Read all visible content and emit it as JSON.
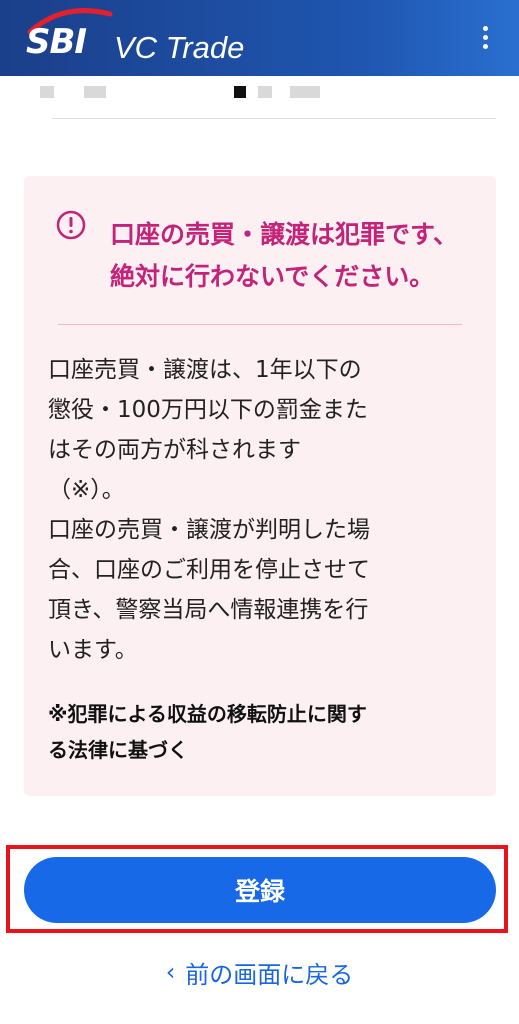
{
  "header": {
    "logo_sbi": "SBI",
    "logo_text": "VC Trade",
    "menu_icon": "kebab-menu-icon",
    "brand_color": "#1f56b0"
  },
  "warning": {
    "icon": "exclamation-circle-icon",
    "title": "口座の売買・譲渡は犯罪です、\n絶対に行わないでください。",
    "body": "口座売買・譲渡は、1年以下の\n懲役・100万円以下の罰金また\nはその両方が科されます\n（※）。\n口座の売買・譲渡が判明した場\n合、口座のご利用を停止させて\n頂き、警察当局へ情報連携を行\nいます。",
    "note": "※犯罪による収益の移転防止に関す\nる法律に基づく",
    "title_color": "#c4237a",
    "background_color": "#fcf0f3"
  },
  "actions": {
    "register_label": "登録",
    "back_label": "前の画面に戻る",
    "back_icon": "chevron-left-icon",
    "button_color": "#1769e8",
    "highlight_color": "#e8141b"
  }
}
